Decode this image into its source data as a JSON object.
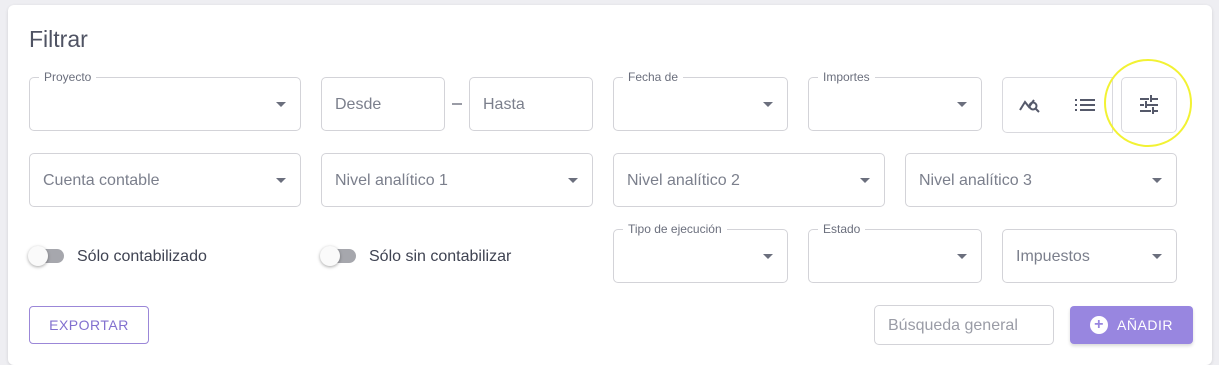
{
  "title": "Filtrar",
  "row1": {
    "proyecto": {
      "label": "Proyecto",
      "value": ""
    },
    "desde": {
      "placeholder": "Desde"
    },
    "range_separator": "–",
    "hasta": {
      "placeholder": "Hasta"
    },
    "fecha_de": {
      "label": "Fecha de",
      "value": ""
    },
    "importes": {
      "label": "Importes",
      "value": ""
    }
  },
  "view_buttons": [
    {
      "icon": "chart-search-icon"
    },
    {
      "icon": "list-icon"
    },
    {
      "icon": "tune-icon",
      "highlighted": true
    }
  ],
  "row2": {
    "cuenta": {
      "placeholder": "Cuenta contable"
    },
    "nivel1": {
      "placeholder": "Nivel analítico 1"
    },
    "nivel2": {
      "placeholder": "Nivel analítico 2"
    },
    "nivel3": {
      "placeholder": "Nivel analítico 3"
    }
  },
  "row3": {
    "toggle1": {
      "label": "Sólo contabilizado",
      "on": false
    },
    "toggle2": {
      "label": "Sólo sin contabilizar",
      "on": false
    },
    "tipo": {
      "label": "Tipo de ejecución",
      "value": ""
    },
    "estado": {
      "label": "Estado",
      "value": ""
    },
    "impuestos": {
      "placeholder": "Impuestos"
    }
  },
  "footer": {
    "export_label": "EXPORTAR",
    "search_placeholder": "Búsqueda general",
    "add_label": "AÑADIR"
  },
  "colors": {
    "accent": "#9886e0",
    "highlight": "#f2f233"
  }
}
